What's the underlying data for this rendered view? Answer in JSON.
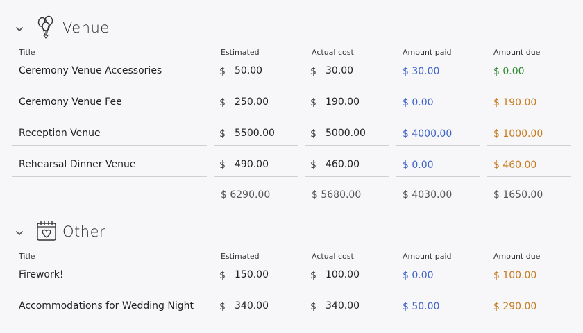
{
  "columns": {
    "title": "Title",
    "estimated": "Estimated",
    "actual": "Actual cost",
    "paid": "Amount paid",
    "due": "Amount due"
  },
  "currency": "$",
  "venue": {
    "title": "Venue",
    "icon": "balloons-icon",
    "rows": [
      {
        "title": "Ceremony Venue Accessories",
        "estimated": "50.00",
        "actual": "30.00",
        "paid": "$ 30.00",
        "due": "$ 0.00"
      },
      {
        "title": "Ceremony Venue Fee",
        "estimated": "250.00",
        "actual": "190.00",
        "paid": "$ 0.00",
        "due": "$ 190.00"
      },
      {
        "title": "Reception Venue",
        "estimated": "5500.00",
        "actual": "5000.00",
        "paid": "$ 4000.00",
        "due": "$ 1000.00"
      },
      {
        "title": "Rehearsal Dinner Venue",
        "estimated": "490.00",
        "actual": "460.00",
        "paid": "$ 0.00",
        "due": "$ 460.00"
      }
    ],
    "totals": {
      "estimated": "$ 6290.00",
      "actual": "$ 5680.00",
      "paid": "$ 4030.00",
      "due": "$ 1650.00"
    }
  },
  "other": {
    "title": "Other",
    "icon": "calendar-heart-icon",
    "rows": [
      {
        "title": "Firework!",
        "estimated": "150.00",
        "actual": "100.00",
        "paid": "$ 0.00",
        "due": "$ 100.00"
      },
      {
        "title": "Accommodations for Wedding Night",
        "estimated": "340.00",
        "actual": "340.00",
        "paid": "$ 50.00",
        "due": "$ 290.00"
      }
    ]
  },
  "colors": {
    "paid": "#3d63c9",
    "due": "#c77b1e",
    "due_zero": "#2f8a2f"
  }
}
